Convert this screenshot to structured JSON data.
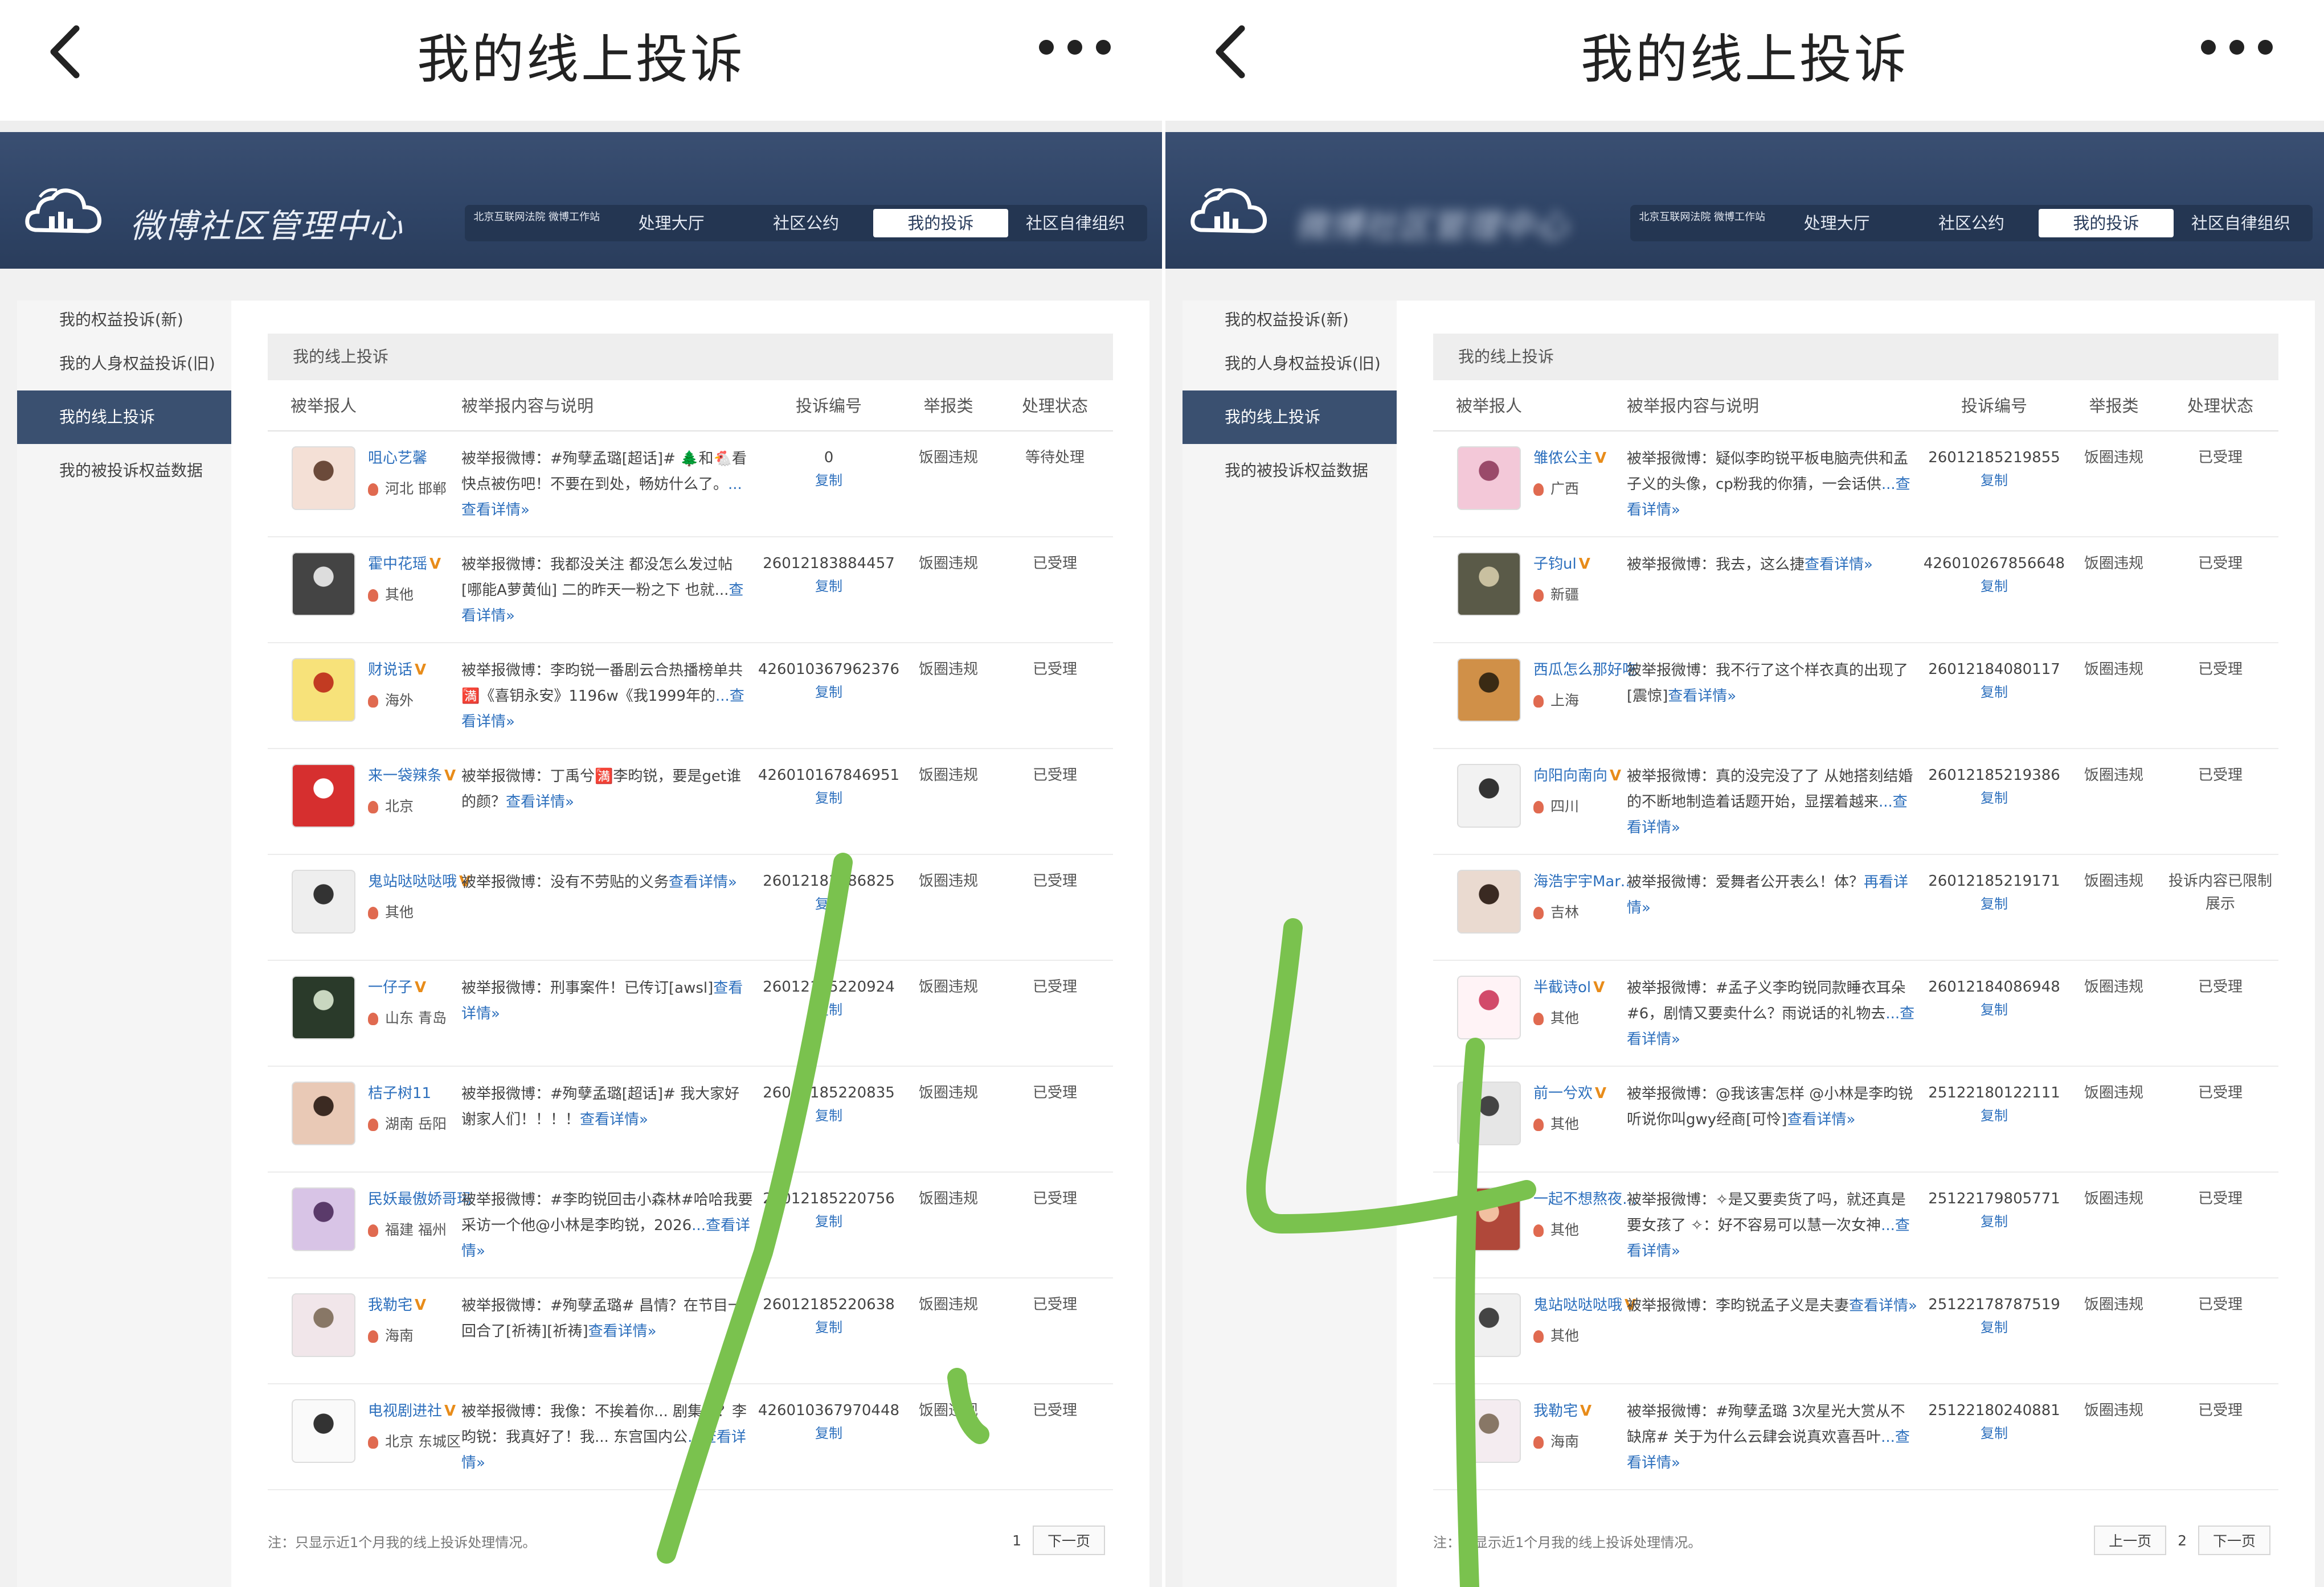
{
  "panels": [
    {
      "appbar": {
        "title": "我的线上投诉"
      },
      "banner": {
        "site_name": "微博社区管理中心"
      },
      "nav": [
        "北京互联网法院 微博工作站",
        "处理大厅",
        "社区公约",
        "我的投诉",
        "社区自律组织"
      ],
      "sidebar": [
        "我的权益投诉(新)",
        "我的人身权益投诉(旧)",
        "我的线上投诉",
        "我的被投诉权益数据"
      ],
      "main_title": "我的线上投诉",
      "headers": [
        "被举报人",
        "被举报内容与说明",
        "投诉编号",
        "举报类",
        "处理状态"
      ],
      "rows": [
        {
          "name": "咀心艺馨",
          "v": "",
          "loc": "河北 邯郸",
          "desc": "被举报微博：#殉孽孟璐[超话]# 🌲和🐔看快点被伤吧！不要在到处，畅妨什么了。",
          "more": "...查看详情»",
          "code": "0",
          "copy": "复制",
          "type": "饭圈违规",
          "status": "等待处理"
        },
        {
          "name": "霍中花瑶",
          "v": "V",
          "loc": "其他",
          "desc": "被举报微博：我都没关注 都没怎么发过帖[哪能A萝黄仙] 二的昨天一粉之下 也就...",
          "more": "查看详情»",
          "code": "26012183884457",
          "copy": "复制",
          "type": "饭圈违规",
          "status": "已受理"
        },
        {
          "name": "财说话",
          "v": "V",
          "loc": "海外",
          "desc": "被举报微博：李昀锐一番剧云合热播榜单共🈵《喜钥永安》1196w《我1999年的",
          "more": "...查看详情»",
          "code": "426010367962376",
          "copy": "复制",
          "type": "饭圈违规",
          "status": "已受理"
        },
        {
          "name": "来一袋辣条",
          "v": "V",
          "loc": "北京",
          "desc": "被举报微博：丁禹兮🈵李昀锐，要是get谁的颜？",
          "more": "查看详情»",
          "code": "426010167846951",
          "copy": "复制",
          "type": "饭圈违规",
          "status": "已受理"
        },
        {
          "name": "鬼站哒哒哒哦",
          "v": "V",
          "loc": "其他",
          "desc": "被举报微博：没有不劳贴的义务",
          "more": "查看详情»",
          "code": "26012183886825",
          "copy": "复制",
          "type": "饭圈违规",
          "status": "已受理"
        },
        {
          "name": "一仔子",
          "v": "V",
          "loc": "山东 青岛",
          "desc": "被举报微博：刑事案件！已传订[awsl]",
          "more": "查看详情»",
          "code": "26012185220924",
          "copy": "复制",
          "type": "饭圈违规",
          "status": "已受理"
        },
        {
          "name": "桔子树11",
          "v": "",
          "loc": "湖南 岳阳",
          "desc": "被举报微博：#殉孽孟璐[超话]# 我大家好 谢家人们！！！！",
          "more": "查看详情»",
          "code": "26012185220835",
          "copy": "复制",
          "type": "饭圈违规",
          "status": "已受理"
        },
        {
          "name": "民妖最傲娇哥玛",
          "v": "",
          "loc": "福建 福州",
          "desc": "被举报微博：#李昀锐回击小森林#哈哈我要采访一个他@小林是李昀锐，2026",
          "more": "...查看详情»",
          "code": "26012185220756",
          "copy": "复制",
          "type": "饭圈违规",
          "status": "已受理"
        },
        {
          "name": "我勒宅",
          "v": "V",
          "loc": "海南",
          "desc": "被举报微博：#殉孽孟璐# 昌情？在节目一回合了[祈祷][祈祷]",
          "more": "查看详情»",
          "code": "26012185220638",
          "copy": "复制",
          "type": "饭圈违规",
          "status": "已受理"
        },
        {
          "name": "电视剧进社",
          "v": "V",
          "loc": "北京 东城区",
          "desc": "被举报微博：我像：不挨着你... 剧集呢？李昀锐：我真好了！我... 东宫国内公",
          "more": "...查看详情»",
          "code": "426010367970448",
          "copy": "复制",
          "type": "饭圈违规",
          "status": "已受理"
        }
      ],
      "footer": {
        "note": "注：只显示近1个月我的线上投诉处理情况。",
        "pages": [
          "1"
        ],
        "prev": "",
        "next": "下一页"
      }
    },
    {
      "appbar": {
        "title": "我的线上投诉"
      },
      "banner": {
        "site_name": "微博社区管理中心"
      },
      "nav": [
        "北京互联网法院 微博工作站",
        "处理大厅",
        "社区公约",
        "我的投诉",
        "社区自律组织"
      ],
      "sidebar": [
        "我的权益投诉(新)",
        "我的人身权益投诉(旧)",
        "我的线上投诉",
        "我的被投诉权益数据"
      ],
      "main_title": "我的线上投诉",
      "headers": [
        "被举报人",
        "被举报内容与说明",
        "投诉编号",
        "举报类",
        "处理状态"
      ],
      "rows": [
        {
          "name": "雏侬公主",
          "v": "V",
          "loc": "广西",
          "desc": "被举报微博：疑似李昀锐平板电脑壳供和孟子义的头像，cp粉我的你猜，一会话供",
          "more": "...查看详情»",
          "code": "26012185219855",
          "copy": "复制",
          "type": "饭圈违规",
          "status": "已受理"
        },
        {
          "name": "子钧ul",
          "v": "V",
          "loc": "新疆",
          "desc": "被举报微博：我去，这么捷",
          "more": "查看详情»",
          "code": "426010267856648",
          "copy": "复制",
          "type": "饭圈违规",
          "status": "已受理"
        },
        {
          "name": "西瓜怎么那好吃",
          "v": "",
          "loc": "上海",
          "desc": "被举报微博：我不行了这个样衣真的出现了[震惊]",
          "more": "查看详情»",
          "code": "26012184080117",
          "copy": "复制",
          "type": "饭圈违规",
          "status": "已受理"
        },
        {
          "name": "向阳向南向",
          "v": "V",
          "loc": "四川",
          "desc": "被举报微博：真的没完没了了 从她搭刻结婚的不断地制造着话题开始，显摆着越来",
          "more": "...查看详情»",
          "code": "26012185219386",
          "copy": "复制",
          "type": "饭圈违规",
          "status": "已受理"
        },
        {
          "name": "海浩宇宇Marg...",
          "v": "V",
          "loc": "吉林",
          "desc": "被举报微博：爱舞者公开表么！体？",
          "more": "再看详情»",
          "code": "26012185219171",
          "copy": "复制",
          "type": "饭圈违规",
          "status": "投诉内容已限制展示"
        },
        {
          "name": "半截诗ol",
          "v": "V",
          "loc": "其他",
          "desc": "被举报微博：#孟子义李昀锐同款睡衣耳朵#6，剧情又要卖什么？雨说话的礼物去",
          "more": "...查看详情»",
          "code": "26012184086948",
          "copy": "复制",
          "type": "饭圈违规",
          "status": "已受理"
        },
        {
          "name": "前一兮欢",
          "v": "V",
          "loc": "其他",
          "desc": "被举报微博：@我该害怎样 @小林是李昀锐 听说你叫gwy经商[可怜]",
          "more": "查看详情»",
          "code": "25122180122111",
          "copy": "复制",
          "type": "饭圈违规",
          "status": "已受理"
        },
        {
          "name": "一起不想熬夜啦",
          "v": "V",
          "loc": "其他",
          "desc": "被举报微博：✧是又要卖货了吗，就还真是要女孩了 ✧：好不容易可以慧一次女神",
          "more": "...查看详情»",
          "code": "25122179805771",
          "copy": "复制",
          "type": "饭圈违规",
          "status": "已受理"
        },
        {
          "name": "鬼站哒哒哒哦",
          "v": "V",
          "loc": "其他",
          "desc": "被举报微博：李昀锐孟子义是夫妻",
          "more": "查看详情»",
          "code": "25122178787519",
          "copy": "复制",
          "type": "饭圈违规",
          "status": "已受理"
        },
        {
          "name": "我勒宅",
          "v": "V",
          "loc": "海南",
          "desc": "被举报微博：#殉孽孟璐 3次星光大赏从不缺席# 关于为什么云肆会说真欢喜吾叶",
          "more": "...查看详情»",
          "code": "25122180240881",
          "copy": "复制",
          "type": "饭圈违规",
          "status": "已受理"
        }
      ],
      "footer": {
        "note": "注：只显示近1个月我的线上投诉处理情况。",
        "pages": [
          "2"
        ],
        "prev": "上一页",
        "next": "下一页"
      }
    }
  ],
  "icons": {
    "back": "chevron-left-icon",
    "more": "more-dots-icon",
    "logo": "cloud-logo-icon",
    "pin": "location-pin-icon"
  },
  "colors": {
    "banner": "#2f4466",
    "link": "#2c6fbd",
    "handwriting": "#7ac24e",
    "active_sidebar": "#3a5070"
  }
}
